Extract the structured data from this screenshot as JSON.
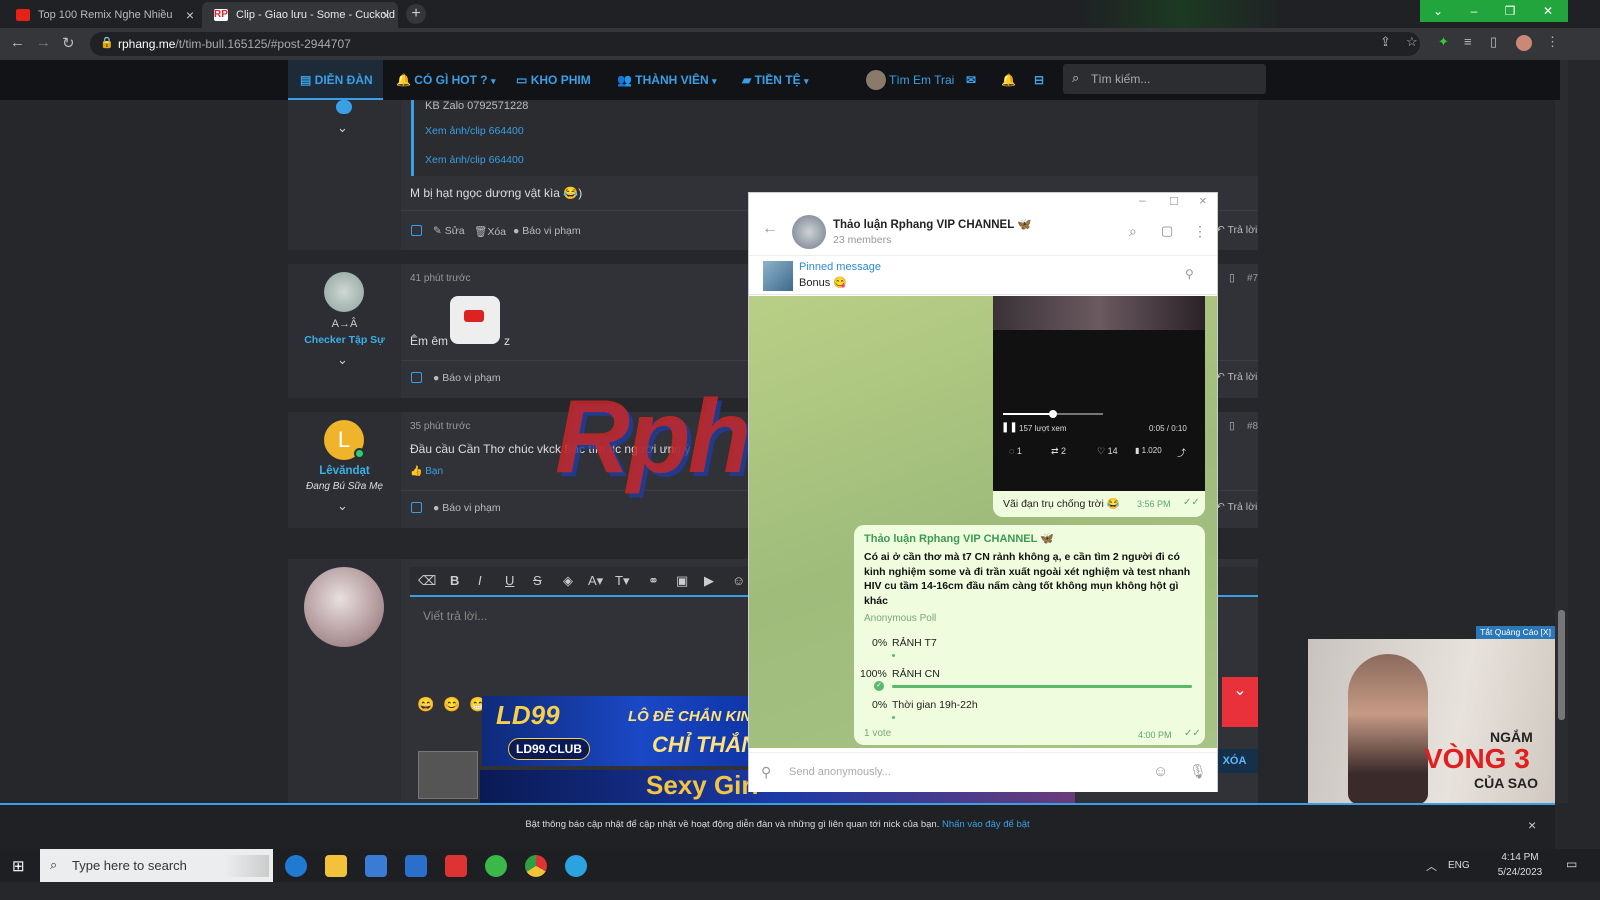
{
  "browser": {
    "tabs": [
      {
        "title": "Top 100 Remix Nghe Nhiều"
      },
      {
        "title": "Clip - Giao lưu - Some - Cuckold"
      }
    ],
    "url_domain": "rphang.me",
    "url_path": "/t/tim-bull.165125/#post-2944707",
    "window_color": "#22a53d"
  },
  "forum_nav": {
    "items": [
      "DIỄN ĐÀN",
      "CÓ GÌ HOT ?",
      "KHO PHIM",
      "THÀNH VIÊN",
      "TIỀN TỆ"
    ],
    "user": "Tìm Em Trai",
    "search_placeholder": "Tìm kiếm..."
  },
  "post_top": {
    "quote_lines": [
      "KB Zalo 0792571228",
      "Xem ảnh/clip 664400",
      "Xem ảnh/clip 664400"
    ],
    "text": "M bị hạt ngọc dương vật kìa 😂)",
    "actions": [
      "Sửa",
      "Xóa",
      "Báo vi phạm"
    ],
    "reply": "Trả lời"
  },
  "post7": {
    "username_line": "A→Â",
    "rank": "Checker Tập Sự",
    "time": "41 phút trước",
    "text": "Êm êm",
    "suffix": "z",
    "report": "Báo vi phạm",
    "reply": "Trả lời",
    "num": "#7"
  },
  "post8": {
    "avatar_letter": "L",
    "username": "Lêvăndạt",
    "status": "Đang Bú Sữa Mẹ",
    "time": "35 phút trước",
    "text": "Đầu cầu Cần Thơ chúc vkck Bác tìm dc người ưng ý",
    "like": "Bạn",
    "report": "Báo vi phạm",
    "reply": "Trả lời",
    "num": "#8"
  },
  "editor": {
    "placeholder": "Viết trả lời...",
    "delete_btn": "XÓA"
  },
  "watermark": "RphangX",
  "telegram": {
    "channel": "Thảo luận Rphang VIP CHANNEL 🦋",
    "members": "23 members",
    "pinned_label": "Pinned message",
    "pinned_text": "Bonus 😋",
    "video": {
      "views": "157 lượt xem",
      "time": "0:05 / 0:10",
      "progress": 0.5,
      "comments": "1",
      "reposts": "2",
      "likes": "14",
      "stats": "1.020"
    },
    "caption": "Vãi đạn trụ chống trời 😂",
    "caption_time": "3:56 PM",
    "post_title": "Thảo luận Rphang VIP CHANNEL 🦋",
    "post_text": "Có ai ở cần thơ mà t7 CN rảnh không ạ, e cần tìm 2 người đi có kinh nghiệm some và đi trần xuất ngoài xét nghiệm và test nhanh HIV cu tầm 14-16cm đầu nấm càng tốt không mụn không hột gì khác",
    "poll_label": "Anonymous Poll",
    "poll": [
      {
        "pct": "0%",
        "label": "RẢNH T7",
        "value": 0
      },
      {
        "pct": "100%",
        "label": "RẢNH CN",
        "value": 1
      },
      {
        "pct": "0%",
        "label": "Thời gian 19h-22h",
        "value": 0
      }
    ],
    "votes": "1 vote",
    "poll_time": "4:00 PM",
    "input_placeholder": "Send anonymously..."
  },
  "ads": {
    "right_close": "Tắt Quảng Cáo [X]",
    "right_text1": "NGẮM",
    "right_text2": "VÒNG 3",
    "right_text3": "CỦA SAO",
    "banner_brand": "LD99",
    "banner_club": "LD99.CLUB",
    "banner_line1": "LÔ ĐỀ CHẮN KIN",
    "banner_line2": "CHỈ THẮNG",
    "banner2_text": "Sexy Girl"
  },
  "notice": {
    "text": "Bật thông báo cập nhật để cập nhật về hoạt động diễn đàn và những gì liên quan tới nick của bạn.",
    "link": "Nhấn vào đây để bật"
  },
  "taskbar": {
    "search_placeholder": "Type here to search",
    "lang": "ENG",
    "time": "4:14 PM",
    "date": "5/24/2023"
  }
}
